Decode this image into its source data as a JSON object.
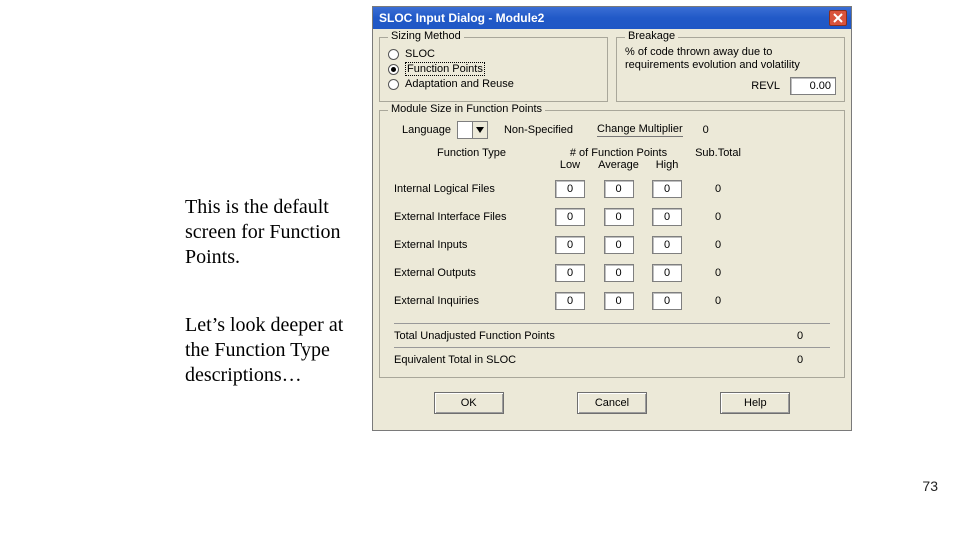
{
  "page_number": "73",
  "annotations": {
    "a1": "This is the default screen for Function Points.",
    "a2": "Let’s look deeper at the Function Type descriptions…"
  },
  "window": {
    "title": "SLOC Input Dialog - Module2",
    "close_icon": "close-icon"
  },
  "sizing": {
    "legend": "Sizing Method",
    "options": {
      "sloc": "SLOC",
      "fp": "Function Points",
      "adapt": "Adaptation and Reuse"
    },
    "selected": "fp"
  },
  "breakage": {
    "legend": "Breakage",
    "desc": "% of code thrown away due to requirements evolution and volatility",
    "revl_label": "REVL",
    "revl_value": "0.00"
  },
  "fp": {
    "legend": "Module Size in Function Points",
    "language_label": "Language",
    "language_value": "",
    "nonspecified": "Non-Specified",
    "change_multiplier_label": "Change Multiplier",
    "change_multiplier_value": "0",
    "table": {
      "header_function_type": "Function Type",
      "header_group": "# of Function Points",
      "header_low": "Low",
      "header_avg": "Average",
      "header_high": "High",
      "header_subtotal": "Sub.Total",
      "rows": [
        {
          "name": "Internal Logical Files",
          "low": "0",
          "avg": "0",
          "high": "0",
          "sub": "0"
        },
        {
          "name": "External Interface Files",
          "low": "0",
          "avg": "0",
          "high": "0",
          "sub": "0"
        },
        {
          "name": "External Inputs",
          "low": "0",
          "avg": "0",
          "high": "0",
          "sub": "0"
        },
        {
          "name": "External Outputs",
          "low": "0",
          "avg": "0",
          "high": "0",
          "sub": "0"
        },
        {
          "name": "External Inquiries",
          "low": "0",
          "avg": "0",
          "high": "0",
          "sub": "0"
        }
      ]
    },
    "totals": {
      "unadjusted_label": "Total Unadjusted Function Points",
      "unadjusted_value": "0",
      "equiv_label": "Equivalent Total in SLOC",
      "equiv_value": "0"
    }
  },
  "buttons": {
    "ok": "OK",
    "cancel": "Cancel",
    "help": "Help"
  }
}
